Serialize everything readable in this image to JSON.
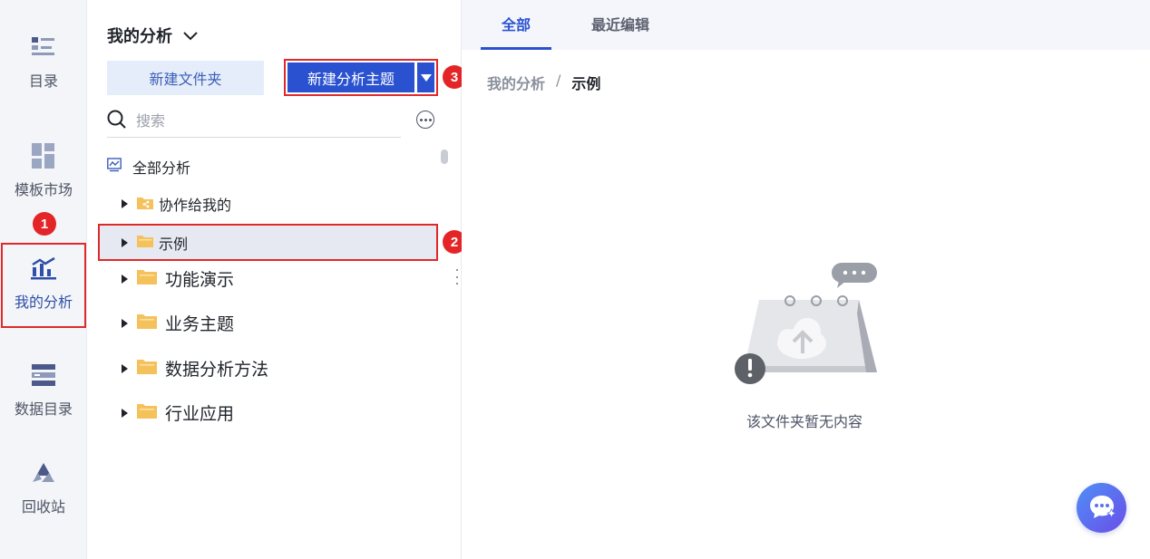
{
  "sidebar": {
    "items": [
      {
        "label": "目录",
        "icon": "catalog-icon"
      },
      {
        "label": "模板市场",
        "icon": "template-grid-icon"
      },
      {
        "label": "我的分析",
        "icon": "analysis-chart-icon",
        "active": true
      },
      {
        "label": "数据目录",
        "icon": "database-icon"
      },
      {
        "label": "回收站",
        "icon": "recycle-icon"
      }
    ]
  },
  "annotations": {
    "step1": "1",
    "step2": "2",
    "step3": "3",
    "highlight_color": "#e02a2a"
  },
  "panel": {
    "title": "我的分析",
    "new_folder_label": "新建文件夹",
    "new_theme_label": "新建分析主题",
    "search_placeholder": "搜索",
    "tree_root": "全部分析",
    "tree": [
      {
        "label": "协作给我的",
        "icon": "shared-folder-icon"
      },
      {
        "label": "示例",
        "icon": "folder-icon",
        "selected": true
      },
      {
        "label": "功能演示",
        "icon": "folder-icon"
      },
      {
        "label": "业务主题",
        "icon": "folder-icon"
      },
      {
        "label": "数据分析方法",
        "icon": "folder-icon"
      },
      {
        "label": "行业应用",
        "icon": "folder-icon"
      }
    ]
  },
  "main": {
    "tabs": [
      {
        "label": "全部",
        "active": true
      },
      {
        "label": "最近编辑"
      }
    ],
    "breadcrumb": {
      "parent": "我的分析",
      "separator": "/",
      "current": "示例"
    },
    "empty_text": "该文件夹暂无内容"
  },
  "colors": {
    "accent": "#2a52d0",
    "folder": "#f5c15a",
    "rail_bg": "#f4f5f8"
  }
}
